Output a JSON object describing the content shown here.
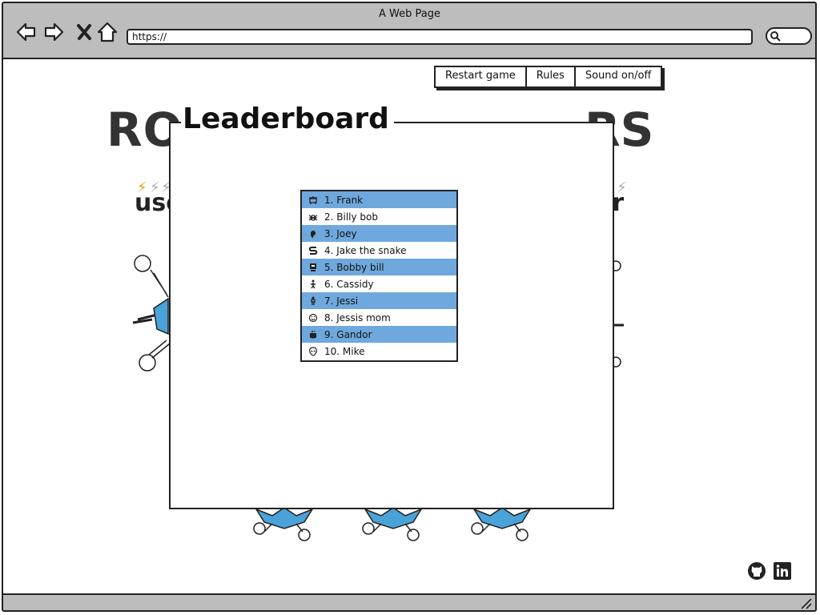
{
  "window": {
    "title": "A Web Page"
  },
  "browser": {
    "url": "https://"
  },
  "background_page": {
    "title_left": "RO",
    "title_right": "RS",
    "side_left": "use",
    "side_right": "er"
  },
  "menu": {
    "items": [
      {
        "label": "Restart game"
      },
      {
        "label": "Rules"
      },
      {
        "label": "Sound on/off"
      }
    ]
  },
  "leaderboard": {
    "title": "Leaderboard",
    "entries": [
      {
        "label": "1. Frank",
        "icon": "robot-icon"
      },
      {
        "label": "2. Billy bob",
        "icon": "bug-icon"
      },
      {
        "label": "3. Joey",
        "icon": "ear-icon"
      },
      {
        "label": "4. Jake the snake",
        "icon": "snake-icon"
      },
      {
        "label": "5. Bobby bill",
        "icon": "robot-head-icon"
      },
      {
        "label": "6. Cassidy",
        "icon": "person-icon"
      },
      {
        "label": "7. Jessi",
        "icon": "person-standing-icon"
      },
      {
        "label": "8. Jessis mom",
        "icon": "face-icon"
      },
      {
        "label": "9. Gandor",
        "icon": "cauldron-icon"
      },
      {
        "label": "10. Mike",
        "icon": "alien-icon"
      }
    ]
  },
  "footer": {
    "icons": [
      "github-icon",
      "linkedin-icon"
    ]
  },
  "colors": {
    "row_highlight": "#6fa8dc",
    "chrome": "#bdbdbd",
    "bolt": "#e0a21a"
  }
}
